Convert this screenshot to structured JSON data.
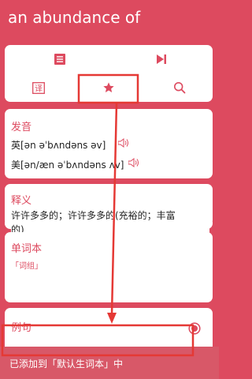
{
  "header": {
    "title": "an abundance of"
  },
  "toolbar": {
    "icons": [
      "list-icon",
      "play-next-icon",
      "translate-icon",
      "star-icon",
      "search-icon"
    ],
    "translate_char": "译"
  },
  "pronunciation": {
    "title": "发音",
    "uk": "英[ən əˈbʌndəns əv]",
    "us": "美[ən/æn əˈbʌndəns ʌv]"
  },
  "definition": {
    "title": "释义",
    "line1": "许许多多的；许许多多的(充裕的；丰富",
    "line2": "的)"
  },
  "wordbook": {
    "title": "单词本",
    "tag": "「词组」"
  },
  "examples": {
    "title": "例句"
  },
  "toast": {
    "text": "已添加到「默认生词本」中"
  },
  "colors": {
    "accent": "#dd4a5f",
    "annotation": "#e53935"
  }
}
